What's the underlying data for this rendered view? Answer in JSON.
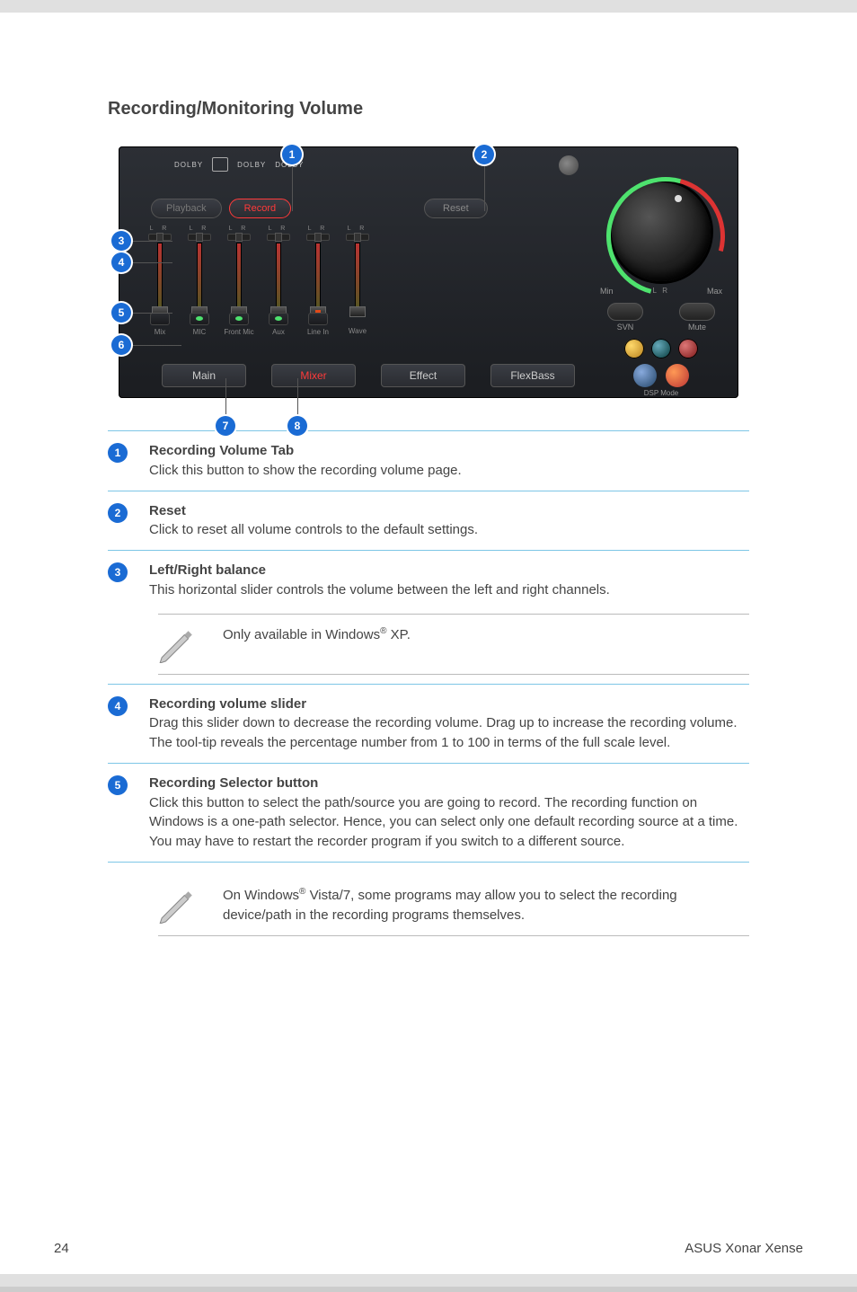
{
  "section_title": "Recording/Monitoring Volume",
  "shot": {
    "logos": [
      "DOLBY",
      "DOLBY",
      "DOLBY"
    ],
    "tabs": {
      "playback": "Playback",
      "record": "Record"
    },
    "reset": "Reset",
    "channels": [
      {
        "name": "Mix",
        "selector": "plain"
      },
      {
        "name": "MIC",
        "selector": "green"
      },
      {
        "name": "Front Mic",
        "selector": "green"
      },
      {
        "name": "Aux",
        "selector": "green"
      },
      {
        "name": "Line In",
        "selector": "plain",
        "knob": "orange"
      },
      {
        "name": "Wave",
        "selector": "none"
      }
    ],
    "bottom_nav": {
      "main": "Main",
      "mixer": "Mixer",
      "effect": "Effect",
      "flexbass": "FlexBass"
    },
    "knob": {
      "min": "Min",
      "max": "Max",
      "svn": "SVN",
      "mute": "Mute",
      "dsp": "DSP Mode"
    }
  },
  "callouts": [
    "1",
    "2",
    "3",
    "4",
    "5",
    "6",
    "7",
    "8"
  ],
  "desc": [
    {
      "n": "1",
      "label": "Recording Volume Tab",
      "body": "Click this button to show the recording volume page."
    },
    {
      "n": "2",
      "label": "Reset",
      "body": "Click to reset all volume controls to the default settings."
    },
    {
      "n": "3",
      "label": "Left/Right balance",
      "body": "This horizontal slider controls the volume between the left and right channels."
    },
    {
      "n": "4",
      "label": "Recording volume slider",
      "body": "Drag this slider down to decrease the recording volume. Drag up to increase the recording volume. The tool-tip reveals the percentage number from 1 to 100 in terms of the full scale level."
    },
    {
      "n": "5",
      "label": "Recording Selector button",
      "body": "Click this button to select the path/source you are going to record. The recording function on Windows is a one-path selector. Hence, you can select only one default recording source at a time. You may have to restart the recorder program if you switch to a different source."
    }
  ],
  "notes": {
    "xp_prefix": "Only available in Windows",
    "xp_suffix": " XP.",
    "vista_prefix": "On Windows",
    "vista_suffix": " Vista/7, some programs may allow you to select the recording device/path in the recording programs themselves."
  },
  "footer": {
    "page": "24",
    "product": "ASUS Xonar Xense"
  }
}
